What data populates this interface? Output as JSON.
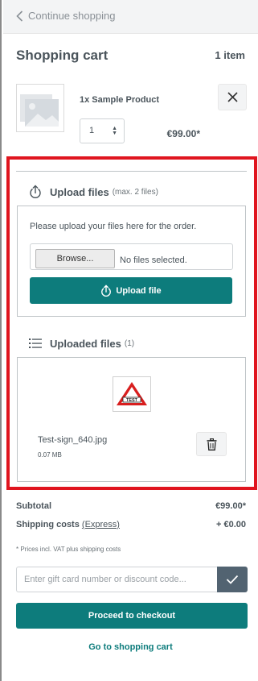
{
  "header": {
    "back_label": "Continue shopping"
  },
  "cart": {
    "title": "Shopping cart",
    "count": "1 item"
  },
  "item": {
    "name": "1x Sample Product",
    "quantity": "1",
    "price": "€99.00*"
  },
  "upload": {
    "title": "Upload files",
    "hint": "(max. 2 files)",
    "instructions": "Please upload your files here for the order.",
    "browse_label": "Browse...",
    "no_files_label": "No files selected.",
    "button_label": "Upload file"
  },
  "uploaded": {
    "title": "Uploaded files",
    "count": "(1)",
    "files": [
      {
        "name": "Test-sign_640.jpg",
        "size": "0.07 MB",
        "thumb_text": "TEST"
      }
    ]
  },
  "summary": {
    "subtotal_label": "Subtotal",
    "subtotal_value": "€99.00*",
    "shipping_label": "Shipping costs",
    "shipping_method": "(Express)",
    "shipping_value": "+ €0.00",
    "vat_note": "* Prices incl. VAT plus shipping costs"
  },
  "promo": {
    "placeholder": "Enter gift card number or discount code..."
  },
  "actions": {
    "checkout_label": "Proceed to checkout",
    "goto_cart_label": "Go to shopping cart"
  },
  "colors": {
    "accent": "#0d7c7c",
    "highlight": "#e0151f",
    "promo_button": "#526371"
  }
}
